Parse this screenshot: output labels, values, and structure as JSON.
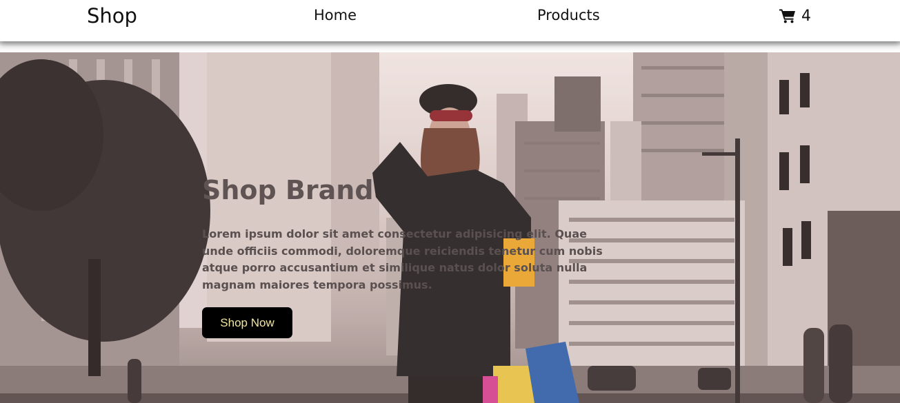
{
  "navbar": {
    "brand": "Shop",
    "links": [
      "Home",
      "Products"
    ],
    "cart_icon": "shopping-cart-icon",
    "cart_count": "4"
  },
  "hero": {
    "title": "Shop Brand",
    "description": "Lorem ipsum dolor sit amet consectetur adipisicing elit. Quae unde officiis commodi, doloremque reiciendis tenetur cum nobis atque porro accusantium et similique natus dolor soluta nulla magnam maiores tempora possimus.",
    "button_label": "Shop Now",
    "background_image": "city-street-shopping-woman-photo"
  },
  "colors": {
    "navbar_bg": "#ffffff",
    "button_bg": "#000000",
    "button_text": "#f2e6a0",
    "hero_title": "#5f5453"
  }
}
